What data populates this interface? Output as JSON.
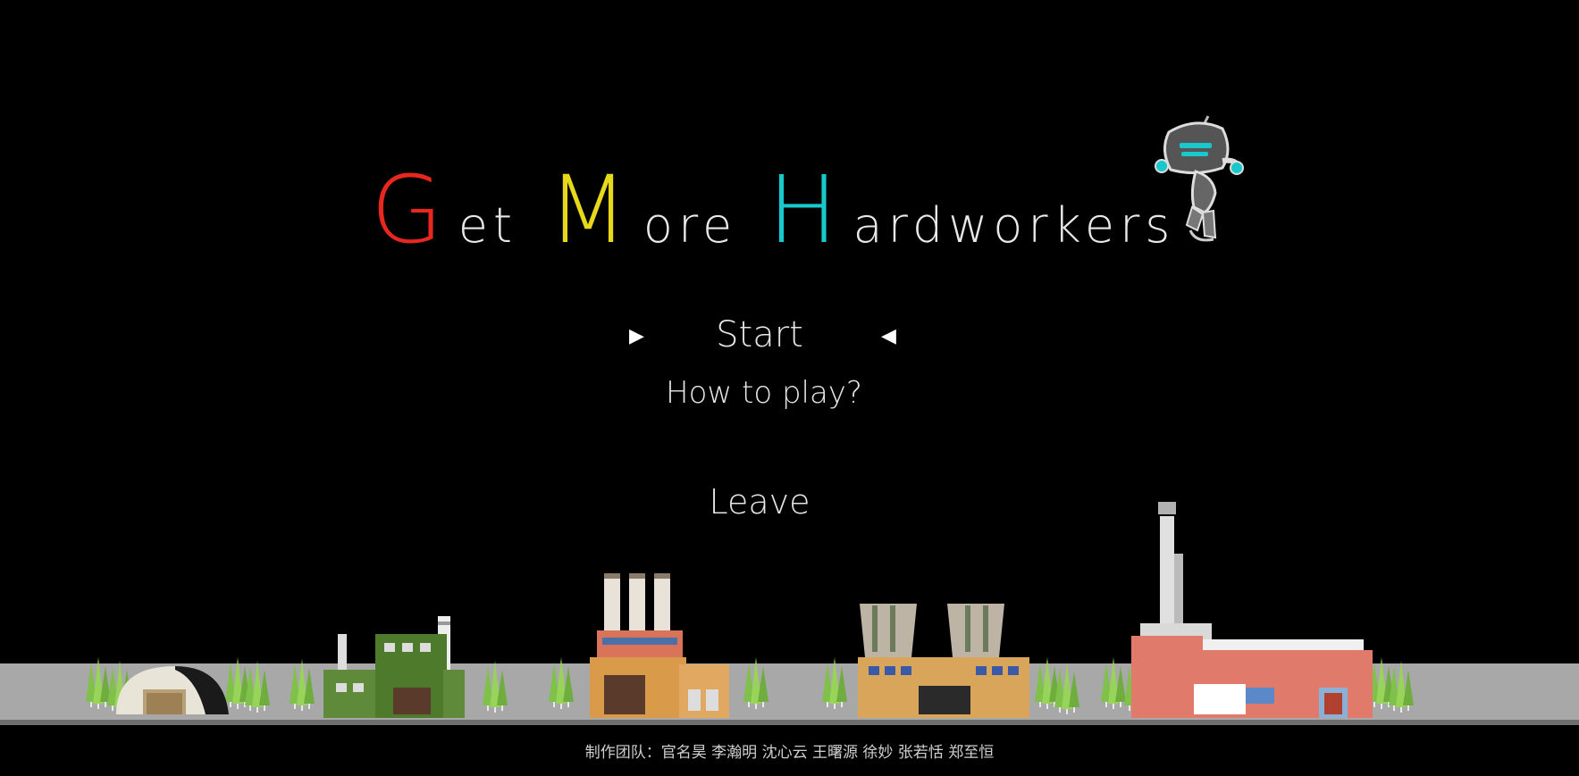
{
  "title": {
    "words": [
      {
        "initial": "G",
        "rest": "et",
        "color": "#e8281e"
      },
      {
        "initial": "M",
        "rest": "ore",
        "color": "#e8d81a"
      },
      {
        "initial": "H",
        "rest": "ardworkers",
        "color": "#18c8cc"
      }
    ]
  },
  "menu": {
    "start_label": "Start",
    "how_to_play_label": "How to play?",
    "leave_label": "Leave",
    "selector_left": "▶",
    "selector_right": "◀"
  },
  "credits": "制作团队：官名昊  李瀚明  沈心云  王曙源  徐妙  张若恬  郑至恒",
  "icons": [
    "robot-mascot-icon",
    "selector-arrow-right-icon",
    "selector-arrow-left-icon"
  ],
  "colors": {
    "background": "#000000",
    "ground": "#a8a8a8",
    "text": "#e6e6e6"
  }
}
